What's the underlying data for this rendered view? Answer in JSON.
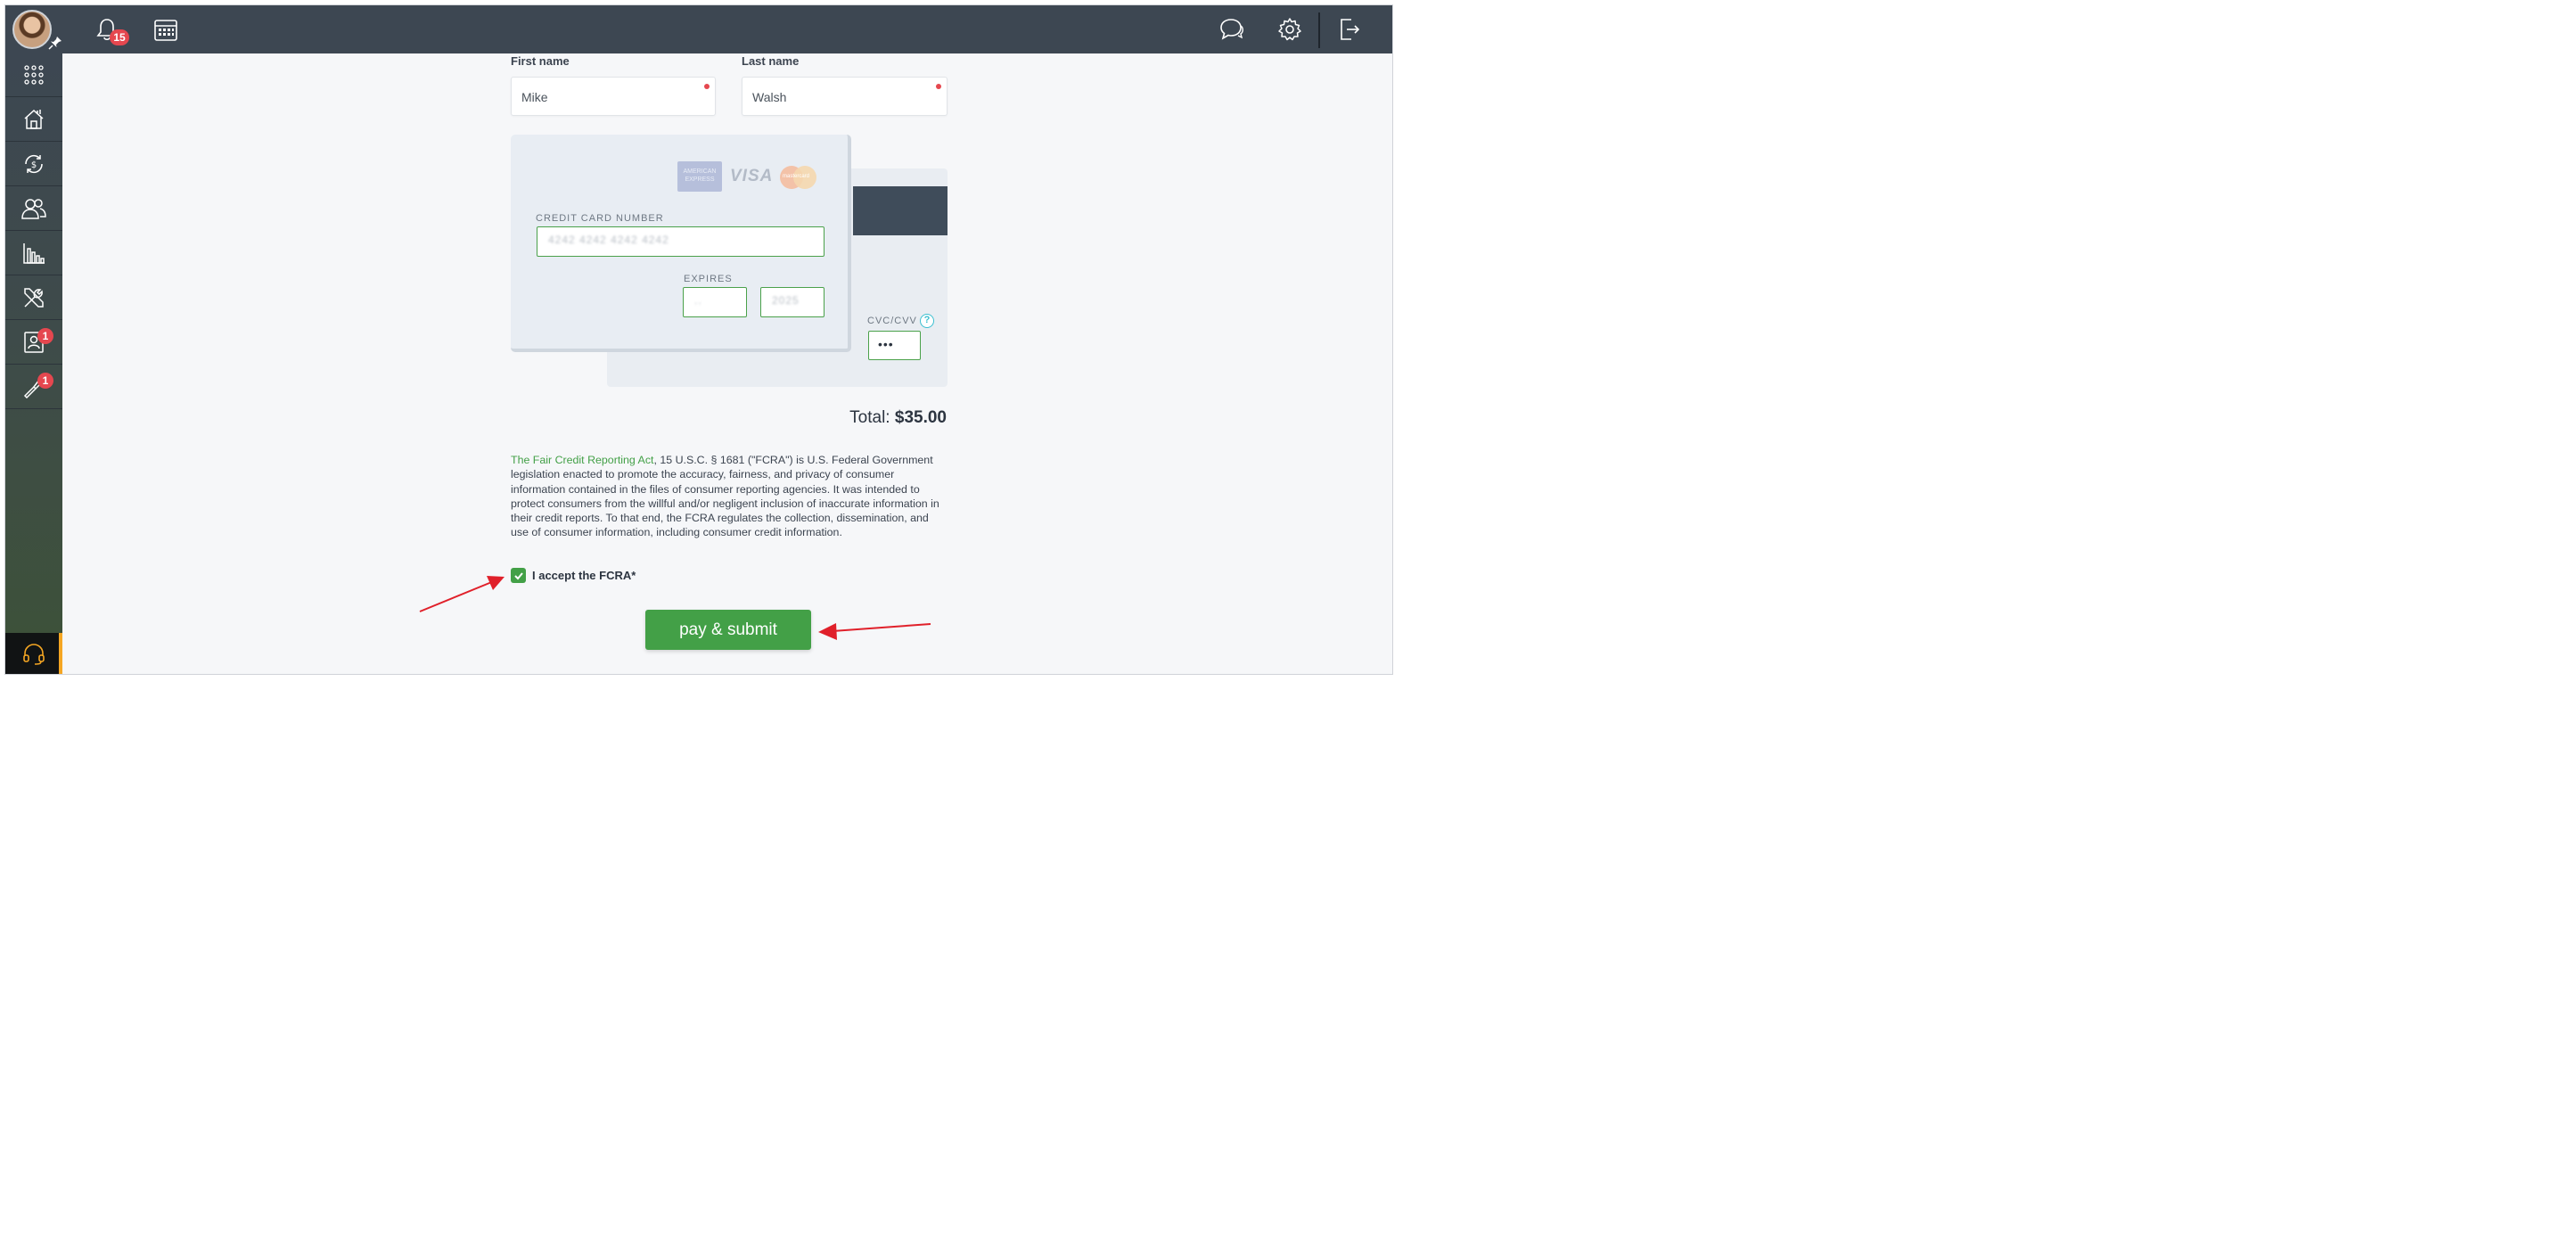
{
  "topbar": {
    "notifications_count": "15",
    "icons": [
      "bell-icon",
      "calendar-icon",
      "chat-icon",
      "gear-icon",
      "logout-icon"
    ]
  },
  "sidebar": {
    "items": [
      {
        "icon": "apps-grid-icon"
      },
      {
        "icon": "home-icon"
      },
      {
        "icon": "dollar-sync-icon"
      },
      {
        "icon": "users-icon"
      },
      {
        "icon": "bar-chart-icon"
      },
      {
        "icon": "tools-icon"
      },
      {
        "icon": "contact-card-icon",
        "badge": "1"
      },
      {
        "icon": "wrench-icon",
        "badge": "1"
      }
    ],
    "support_icon": "headset-icon"
  },
  "form": {
    "first_name_label": "First name",
    "first_name_value": "Mike",
    "last_name_label": "Last name",
    "last_name_value": "Walsh"
  },
  "card": {
    "brands": [
      "AMERICAN EXPRESS",
      "VISA",
      "mastercard"
    ],
    "number_label": "CREDIT CARD NUMBER",
    "number_value": "4242 4242 4242 4242",
    "expires_label": "EXPIRES",
    "exp_month_value": "..",
    "exp_year_value": "2025",
    "cvc_label": "CVC/CVV",
    "cvc_value": "•••",
    "help_glyph": "?"
  },
  "total": {
    "label": "Total:",
    "amount": "$35.00"
  },
  "fcra": {
    "link_text": "The Fair Credit Reporting Act",
    "body_text": ", 15 U.S.C. § 1681 (\"FCRA\") is U.S. Federal Government legislation enacted to promote the accuracy, fairness, and privacy of consumer information contained in the files of consumer reporting agencies. It was intended to protect consumers from the willful and/or negligent inclusion of inaccurate information in their credit reports. To that end, the FCRA regulates the collection, dissemination, and use of consumer information, including consumer credit information.",
    "accept_label": "I accept the FCRA*",
    "accepted": true
  },
  "submit": {
    "label": "pay & submit"
  },
  "colors": {
    "topbar": "#3d4752",
    "accent_green": "#43a047",
    "badge_red": "#e5474f",
    "arrow_red": "#e0202a"
  }
}
